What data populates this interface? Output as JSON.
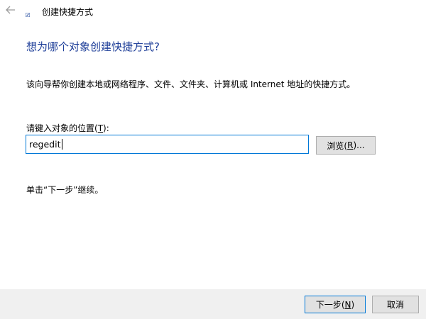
{
  "window": {
    "title": "创建快捷方式"
  },
  "heading": "想为哪个对象创建快捷方式?",
  "description": "该向导帮你创建本地或网络程序、文件、文件夹、计算机或 Internet 地址的快捷方式。",
  "field": {
    "label_prefix": "请键入对象的位置(",
    "label_key": "T",
    "label_suffix": "):",
    "value": "regedit"
  },
  "browse_button": {
    "prefix": "浏览(",
    "key": "R",
    "suffix": ")..."
  },
  "hint": "单击“下一步”继续。",
  "next_button": {
    "prefix": "下一步(",
    "key": "N",
    "suffix": ")"
  },
  "cancel_button": "取消",
  "icons": {
    "back": "back-arrow-icon",
    "app": "shortcut-app-icon"
  },
  "colors": {
    "heading": "#1f3f99",
    "focus_border": "#0078d7",
    "footer_bg": "#f0f0f0"
  }
}
